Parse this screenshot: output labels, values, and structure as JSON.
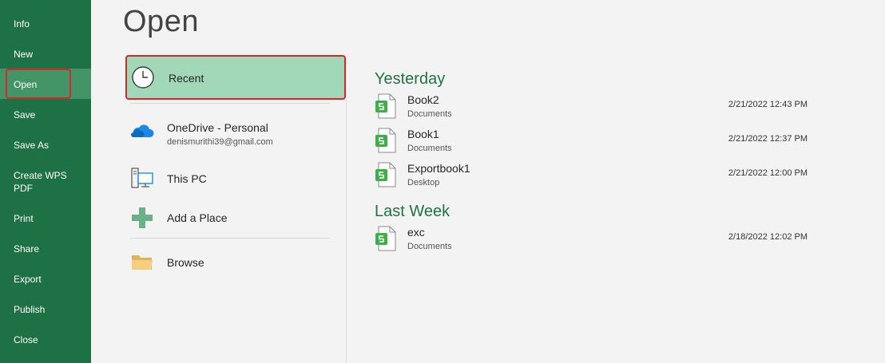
{
  "sidebar": {
    "items": [
      {
        "key": "info",
        "label": "Info"
      },
      {
        "key": "new",
        "label": "New"
      },
      {
        "key": "open",
        "label": "Open"
      },
      {
        "key": "save",
        "label": "Save"
      },
      {
        "key": "save-as",
        "label": "Save As"
      },
      {
        "key": "create-wps-pdf",
        "label": "Create WPS PDF"
      },
      {
        "key": "print",
        "label": "Print"
      },
      {
        "key": "share",
        "label": "Share"
      },
      {
        "key": "export",
        "label": "Export"
      },
      {
        "key": "publish",
        "label": "Publish"
      },
      {
        "key": "close",
        "label": "Close"
      }
    ],
    "active": "open"
  },
  "main": {
    "title": "Open",
    "locations": {
      "recent": {
        "label": "Recent",
        "icon": "clock-icon"
      },
      "onedrive": {
        "label": "OneDrive - Personal",
        "account": "denismurithi39@gmail.com",
        "icon": "cloud-icon"
      },
      "this_pc": {
        "label": "This PC",
        "icon": "computer-icon"
      },
      "add_place": {
        "label": "Add a Place",
        "icon": "plus-icon"
      },
      "browse": {
        "label": "Browse",
        "icon": "folder-icon"
      }
    },
    "groups": [
      {
        "title": "Yesterday",
        "files": [
          {
            "name": "Book2",
            "location": "Documents",
            "date": "2/21/2022 12:43 PM"
          },
          {
            "name": "Book1",
            "location": "Documents",
            "date": "2/21/2022 12:37 PM"
          },
          {
            "name": "Exportbook1",
            "location": "Desktop",
            "date": "2/21/2022 12:00 PM"
          }
        ]
      },
      {
        "title": "Last Week",
        "files": [
          {
            "name": "exc",
            "location": "Documents",
            "date": "2/18/2022 12:02 PM"
          }
        ]
      }
    ]
  },
  "colors": {
    "sidebar": "#1e7145",
    "sidebar_active": "#439467",
    "recent_highlight": "#a0d8b8",
    "accent_text": "#217346",
    "outline": "#d9262b"
  }
}
